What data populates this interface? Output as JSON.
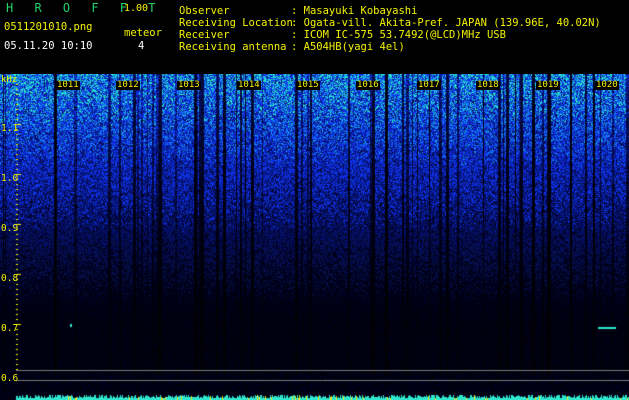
{
  "header": {
    "app_title": "H R O F F T",
    "version": "1.00",
    "filename": "0511201010.png",
    "meteor_label": "meteor",
    "timestamp": "05.11.20 10:10",
    "meteor_count": "4",
    "info": [
      {
        "label": "Observer",
        "value": ": Masayuki Kobayashi"
      },
      {
        "label": "Receiving Location",
        "value": ": Ogata-vill. Akita-Pref. JAPAN (139.96E, 40.02N)"
      },
      {
        "label": "Receiver",
        "value": ": ICOM IC-575 53.7492(@LCD)MHz USB"
      },
      {
        "label": "Receiving antenna",
        "value": ": A504HB(yagi 4el)"
      }
    ]
  },
  "spectrogram": {
    "y_unit": "kHz",
    "y_ticks": [
      "1.1",
      "1.0",
      "0.9",
      "0.8",
      "0.7",
      "0.6"
    ],
    "minute_labels": [
      "1011",
      "1012",
      "1013",
      "1014",
      "1015",
      "1016",
      "1017",
      "1018",
      "1019",
      "1020"
    ]
  },
  "colors": {
    "text_yellow": "#f2f200",
    "text_white": "#ffffff",
    "title_green": "#22d36a",
    "background": "#000000",
    "signal_blue": "#1a3cff",
    "signal_cyan": "#2ee8d0"
  }
}
